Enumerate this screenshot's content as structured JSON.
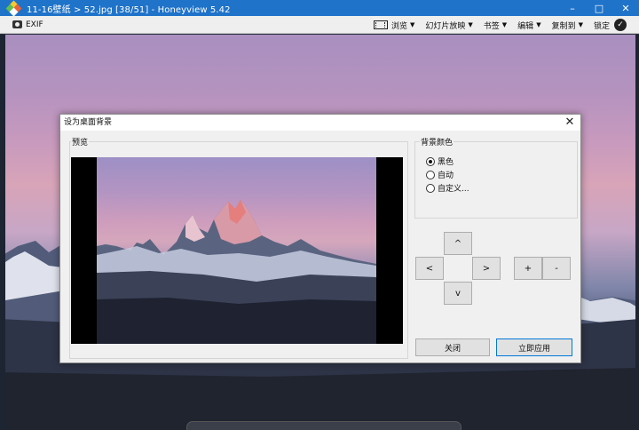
{
  "window": {
    "title": "11-16壁纸 > 52.jpg [38/51] - Honeyview 5.42"
  },
  "toolbar": {
    "exif_label": "EXIF",
    "browse_label": "浏览",
    "slideshow_label": "幻灯片放映",
    "bookmark_label": "书签",
    "edit_label": "编辑",
    "copyto_label": "复制到",
    "lock_label": "锁定"
  },
  "dialog": {
    "title": "设为桌面背景",
    "preview_label": "预览",
    "bgcolor_label": "背景颜色",
    "options": [
      {
        "label": "黑色",
        "selected": true
      },
      {
        "label": "自动",
        "selected": false
      },
      {
        "label": "自定义...",
        "selected": false
      }
    ],
    "arrows": {
      "up": "^",
      "left": "<",
      "right": ">",
      "down": "v"
    },
    "zoom": {
      "in": "+",
      "out": "-"
    },
    "close_label": "关闭",
    "apply_label": "立即应用"
  },
  "colors": {
    "titlebar": "#1f73c9",
    "toolbar": "#efefef",
    "dialog": "#f0f0f0",
    "primary_border": "#0078d7"
  }
}
